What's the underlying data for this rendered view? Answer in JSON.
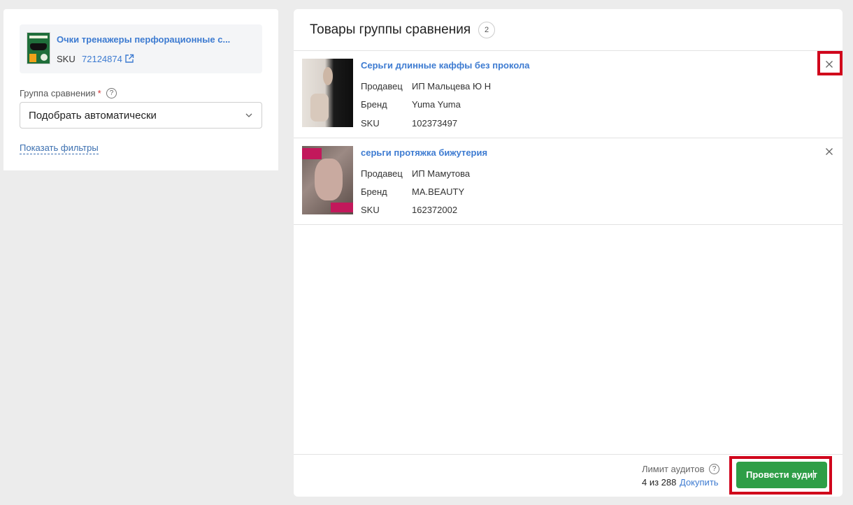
{
  "left_panel": {
    "product": {
      "title": "Очки тренажеры перфорационные с...",
      "sku_label": "SKU",
      "sku_value": "72124874",
      "image_icon": "glasses-product-image",
      "external_link_icon": "external-link-icon"
    },
    "group": {
      "label": "Группа сравнения",
      "required_mark": "*",
      "help_glyph": "?",
      "selected": "Подобрать автоматически"
    },
    "filters_link": "Показать фильтры"
  },
  "right_panel": {
    "title": "Товары группы сравнения",
    "count": "2",
    "items": [
      {
        "title": "Серьги длинные каффы без прокола",
        "seller_label": "Продавец",
        "seller": "ИП Мальцева Ю Н",
        "brand_label": "Бренд",
        "brand": "Yuma Yuma",
        "sku_label": "SKU",
        "sku": "102373497"
      },
      {
        "title": "серьги протяжка бижутерия",
        "seller_label": "Продавец",
        "seller": "ИП Мамутова",
        "brand_label": "Бренд",
        "brand": "MA.BEAUTY",
        "sku_label": "SKU",
        "sku": "162372002"
      }
    ],
    "footer": {
      "limit_label": "Лимит аудитов",
      "help_glyph": "?",
      "limit_count": "4 из 288",
      "buy_more_link": "Докупить",
      "audit_button": "Провести аудит"
    }
  },
  "colors": {
    "link": "#3d7bd1",
    "primary_button": "#2e9e47",
    "highlight": "#d0021b",
    "page_background": "#ececec"
  }
}
